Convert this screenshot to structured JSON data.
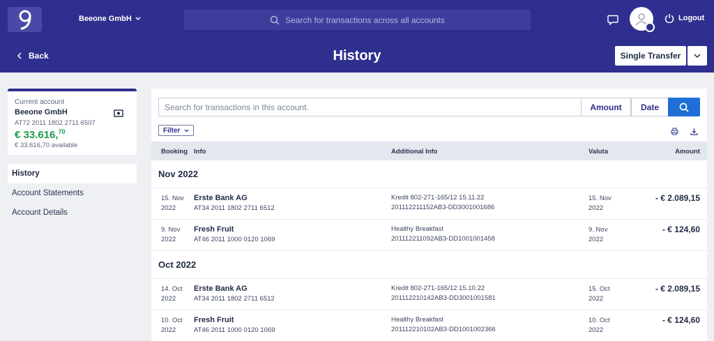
{
  "header": {
    "company": "Beeone GmbH",
    "search_placeholder": "Search for transactions across all accounts",
    "logout_label": "Logout"
  },
  "subheader": {
    "back_label": "Back",
    "title": "History",
    "single_transfer_label": "Single Transfer"
  },
  "account": {
    "label": "Current account",
    "name": "Beeone GmbH",
    "iban": "AT72 2011 1802 2711 6507",
    "balance_main": "€ 33.616,",
    "balance_cents": "70",
    "available": "€ 33.616,70 available"
  },
  "nav": {
    "items": [
      {
        "label": "History"
      },
      {
        "label": "Account Statements"
      },
      {
        "label": "Account Details"
      }
    ]
  },
  "toolbar": {
    "search_placeholder": "Search for transactions in this account.",
    "amount_label": "Amount",
    "date_label": "Date",
    "filter_label": "Filter"
  },
  "table": {
    "headers": {
      "booking": "Booking",
      "info": "Info",
      "additional": "Additional Info",
      "valuta": "Valuta",
      "amount": "Amount"
    },
    "groups": [
      {
        "title": "Nov 2022",
        "rows": [
          {
            "booking_1": "15. Nov",
            "booking_2": "2022",
            "name": "Erste Bank AG",
            "iban": "AT34 2011 1802 2711 6512",
            "add_1": "Kredit 802-271-165/12 15.11.22",
            "add_2": "201112211152AB3-DD3001001686",
            "valuta_1": "15. Nov",
            "valuta_2": "2022",
            "amount": "- € 2.089,15"
          },
          {
            "booking_1": "9. Nov",
            "booking_2": "2022",
            "name": "Fresh Fruit",
            "iban": "AT46 2011 1000 0120 1069",
            "add_1": "Healthy Breakfast",
            "add_2": "201112211092AB3-DD1001001458",
            "valuta_1": "9. Nov",
            "valuta_2": "2022",
            "amount": "- € 124,60"
          }
        ]
      },
      {
        "title": "Oct 2022",
        "rows": [
          {
            "booking_1": "14. Oct",
            "booking_2": "2022",
            "name": "Erste Bank AG",
            "iban": "AT34 2011 1802 2711 6512",
            "add_1": "Kredit 802-271-165/12 15.10.22",
            "add_2": "201112210142AB3-DD3001001581",
            "valuta_1": "15. Oct",
            "valuta_2": "2022",
            "amount": "- € 2.089,15"
          },
          {
            "booking_1": "10. Oct",
            "booking_2": "2022",
            "name": "Fresh Fruit",
            "iban": "AT46 2011 1000 0120 1069",
            "add_1": "Healthy Breakfast",
            "add_2": "201112210102AB3-DD1001002366",
            "valuta_1": "10. Oct",
            "valuta_2": "2022",
            "amount": "- € 124,60"
          }
        ]
      }
    ]
  },
  "icons": {
    "logo": "brand-logo-icon",
    "search": "search-icon",
    "chat": "chat-icon",
    "user": "user-icon",
    "power": "power-icon",
    "print": "print-icon",
    "download": "download-icon",
    "wallet": "wallet-icon"
  },
  "colors": {
    "brand": "#2f2f8f",
    "primary_button": "#1f6fd6",
    "balance": "#1c9a4c"
  }
}
